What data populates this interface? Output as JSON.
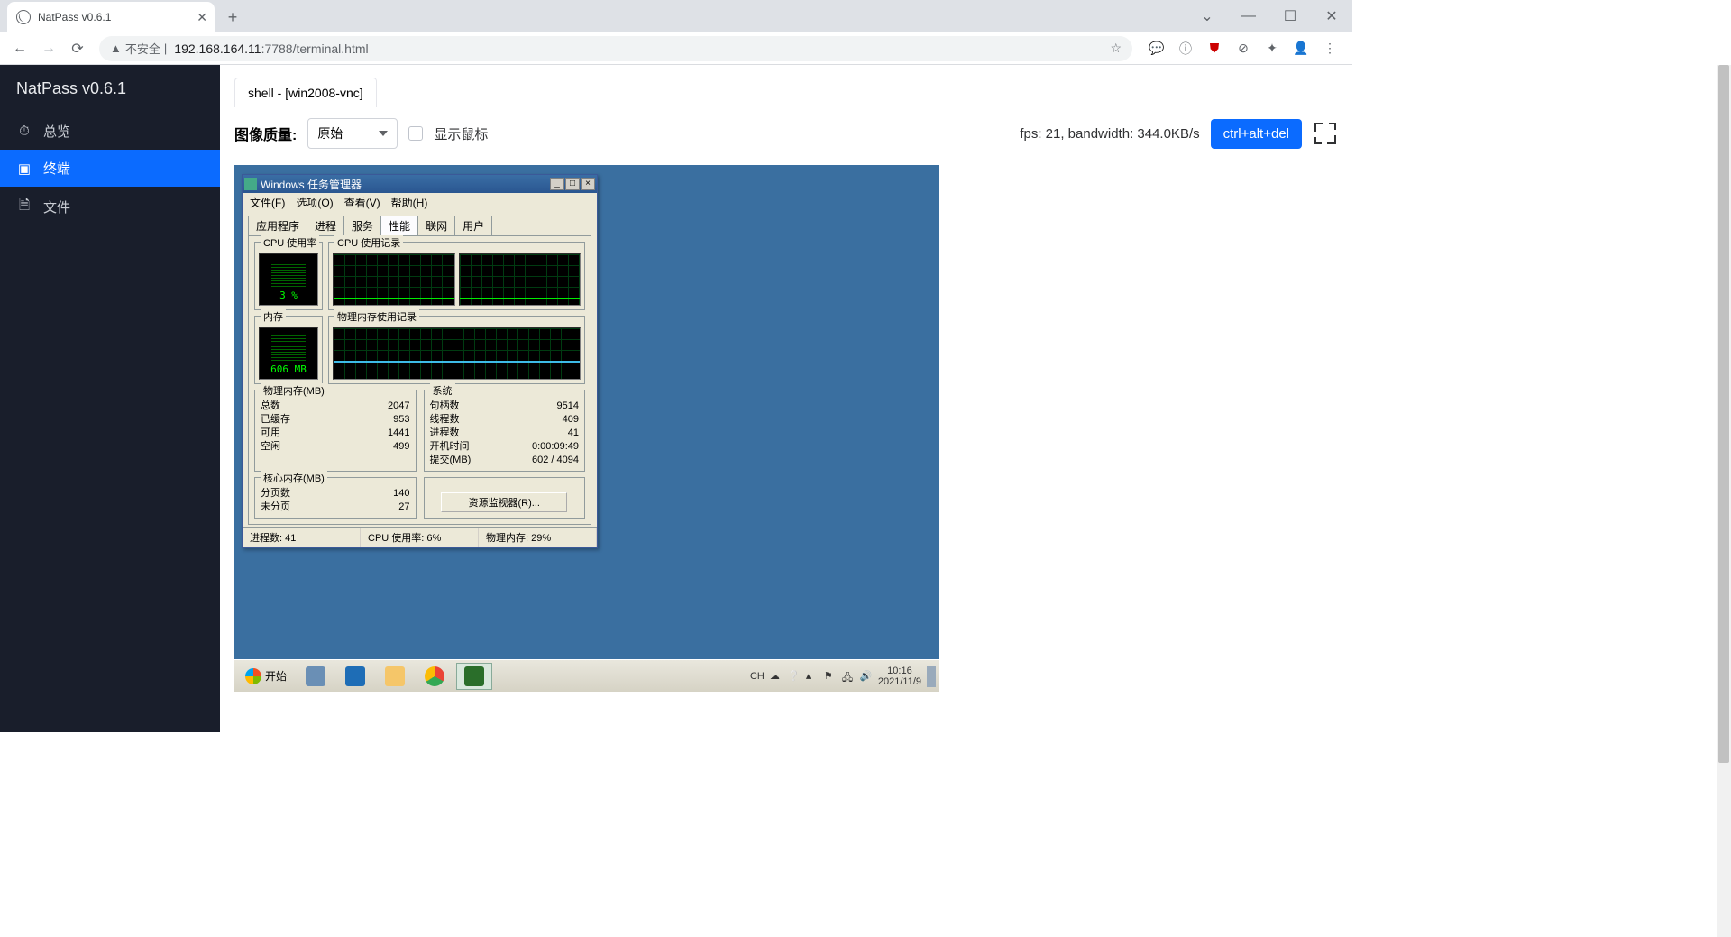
{
  "browser": {
    "tab_title": "NatPass v0.6.1",
    "insecure_label": "不安全",
    "url_ip": "192.168.164.11",
    "url_rest": ":7788/terminal.html"
  },
  "sidebar": {
    "title": "NatPass v0.6.1",
    "items": [
      {
        "label": "总览",
        "icon": "dashboard"
      },
      {
        "label": "终端",
        "icon": "terminal"
      },
      {
        "label": "文件",
        "icon": "file"
      }
    ]
  },
  "apptab": {
    "label": "shell - [win2008-vnc]"
  },
  "controls": {
    "quality_label": "图像质量:",
    "quality_value": "原始",
    "show_cursor_label": "显示鼠标",
    "stats": "fps: 21, bandwidth: 344.0KB/s",
    "cad_button": "ctrl+alt+del"
  },
  "taskmgr": {
    "title": "Windows 任务管理器",
    "menu": {
      "file": "文件(F)",
      "options": "选项(O)",
      "view": "查看(V)",
      "help": "帮助(H)"
    },
    "tabs": {
      "apps": "应用程序",
      "processes": "进程",
      "services": "服务",
      "performance": "性能",
      "networking": "联网",
      "users": "用户"
    },
    "gauges": {
      "cpu_usage_label": "CPU 使用率",
      "cpu_history_label": "CPU 使用记录",
      "mem_label": "内存",
      "mem_history_label": "物理内存使用记录",
      "cpu_value": "3 %",
      "mem_value": "606 MB"
    },
    "physmem": {
      "legend": "物理内存(MB)",
      "total_l": "总数",
      "total_v": "2047",
      "cached_l": "已缓存",
      "cached_v": "953",
      "avail_l": "可用",
      "avail_v": "1441",
      "free_l": "空闲",
      "free_v": "499"
    },
    "kernel": {
      "legend": "核心内存(MB)",
      "paged_l": "分页数",
      "paged_v": "140",
      "nonpaged_l": "未分页",
      "nonpaged_v": "27"
    },
    "system": {
      "legend": "系统",
      "handles_l": "句柄数",
      "handles_v": "9514",
      "threads_l": "线程数",
      "threads_v": "409",
      "procs_l": "进程数",
      "procs_v": "41",
      "uptime_l": "开机时间",
      "uptime_v": "0:00:09:49",
      "commit_l": "提交(MB)",
      "commit_v": "602 / 4094"
    },
    "resource_monitor_btn": "资源监视器(R)...",
    "status": {
      "processes": "进程数: 41",
      "cpu": "CPU 使用率: 6%",
      "mem": "物理内存: 29%"
    }
  },
  "taskbar": {
    "start": "开始",
    "lang": "CH",
    "time": "10:16",
    "date": "2021/11/9"
  }
}
